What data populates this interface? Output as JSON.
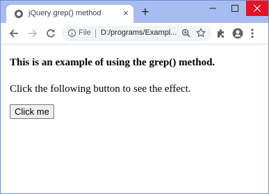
{
  "browser": {
    "tab_title": "jQuery grep() method",
    "tab_close": "×",
    "new_tab": "+",
    "window_controls": {
      "minimize": "minimize-icon",
      "maximize": "maximize-icon",
      "close": "close-icon"
    },
    "address_bar": {
      "scheme_label": "File",
      "url": "D:/programs/Exampl..."
    },
    "icons": [
      "back-arrow-icon",
      "forward-arrow-icon",
      "reload-icon",
      "info-icon",
      "zoom-icon",
      "star-icon",
      "extensions-icon",
      "profile-icon",
      "menu-icon"
    ],
    "colors": {
      "titlebar": "#a7bdf1",
      "close_button": "#e81123",
      "omnibox": "#f1f3f4"
    }
  },
  "page": {
    "heading": "This is an example of using the grep() method.",
    "description": "Click the following button to see the effect.",
    "button_label": "Click me"
  }
}
